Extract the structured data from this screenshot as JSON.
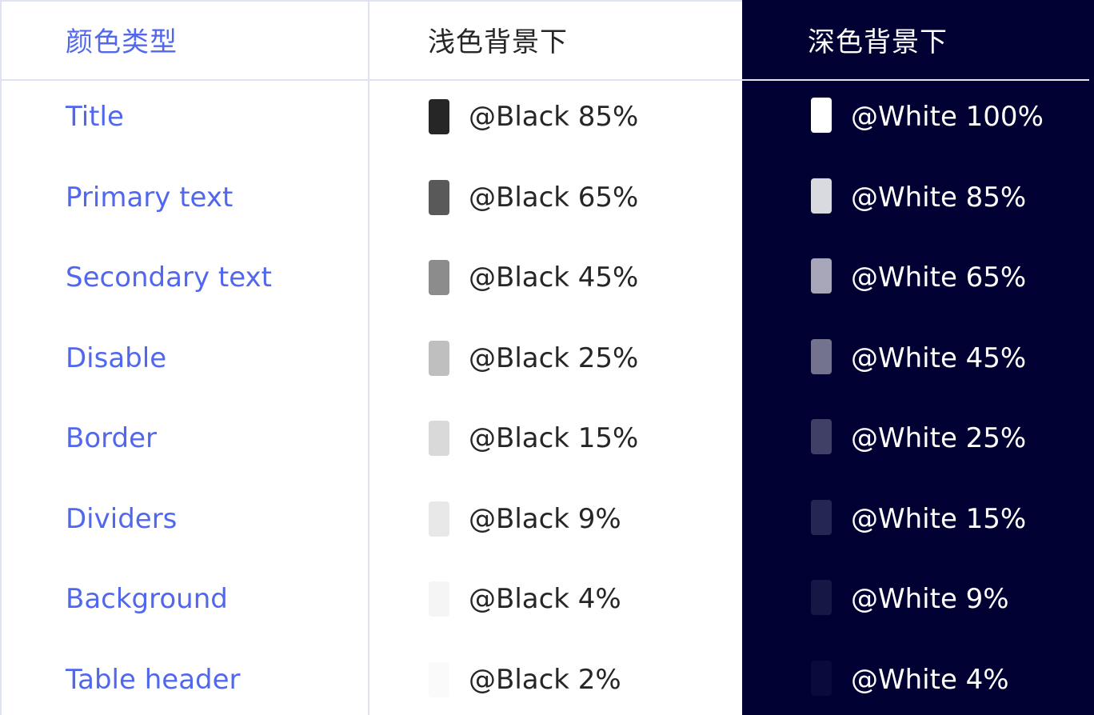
{
  "header": {
    "type_col": "颜色类型",
    "light_col": "浅色背景下",
    "dark_col": "深色背景下"
  },
  "rows": [
    {
      "type": "Title",
      "light": "@Black 85%",
      "light_color": "#262626",
      "dark": "@White 100%",
      "dark_color": "#ffffff"
    },
    {
      "type": "Primary text",
      "light": "@Black 65%",
      "light_color": "#595959",
      "dark": "@White 85%",
      "dark_color": "#d9d9e0"
    },
    {
      "type": "Secondary text",
      "light": "@Black 45%",
      "light_color": "#8c8c8c",
      "dark": "@White 65%",
      "dark_color": "#a6a6b8"
    },
    {
      "type": "Disable",
      "light": "@Black 25%",
      "light_color": "#bfbfbf",
      "dark": "@White 45%",
      "dark_color": "#737390"
    },
    {
      "type": "Border",
      "light": "@Black 15%",
      "light_color": "#d9d9d9",
      "dark": "@White 25%",
      "dark_color": "#404066"
    },
    {
      "type": "Dividers",
      "light": "@Black 9%",
      "light_color": "#e8e8e8",
      "dark": "@White 15%",
      "dark_color": "#262652"
    },
    {
      "type": "Background",
      "light": "@Black 4%",
      "light_color": "#f5f5f5",
      "dark": "@White 9%",
      "dark_color": "#171745"
    },
    {
      "type": "Table header",
      "light": "@Black 2%",
      "light_color": "#fafafa",
      "dark": "@White 4%",
      "dark_color": "#0a0a3d"
    }
  ],
  "colors": {
    "accent": "#5067ee",
    "dark_background": "#000033",
    "grid_line": "#dde3f5"
  }
}
